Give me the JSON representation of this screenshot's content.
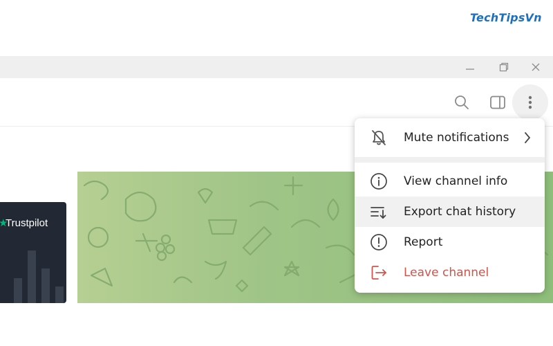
{
  "watermark": "TechTipsVn",
  "window_controls": {
    "minimize_icon": "minimize-icon",
    "restore_icon": "restore-icon",
    "close_icon": "close-icon"
  },
  "header_actions": {
    "search_icon": "search-icon",
    "sidebar_toggle_icon": "sidebar-toggle-icon",
    "more_icon": "more-vertical-icon"
  },
  "left_card": {
    "label": "Trustpilot",
    "icon": "trustpilot-star-icon"
  },
  "context_menu": {
    "items": [
      {
        "label": "Mute notifications",
        "icon": "mute-bell-icon",
        "has_submenu": true
      },
      {
        "label": "View channel info",
        "icon": "info-icon"
      },
      {
        "label": "Export chat history",
        "icon": "export-list-icon"
      },
      {
        "label": "Report",
        "icon": "report-icon"
      },
      {
        "label": "Leave channel",
        "icon": "leave-icon"
      }
    ]
  },
  "colors": {
    "chat_background": "#9fc487",
    "danger": "#d0544b",
    "watermark": "#1f6fbf"
  }
}
